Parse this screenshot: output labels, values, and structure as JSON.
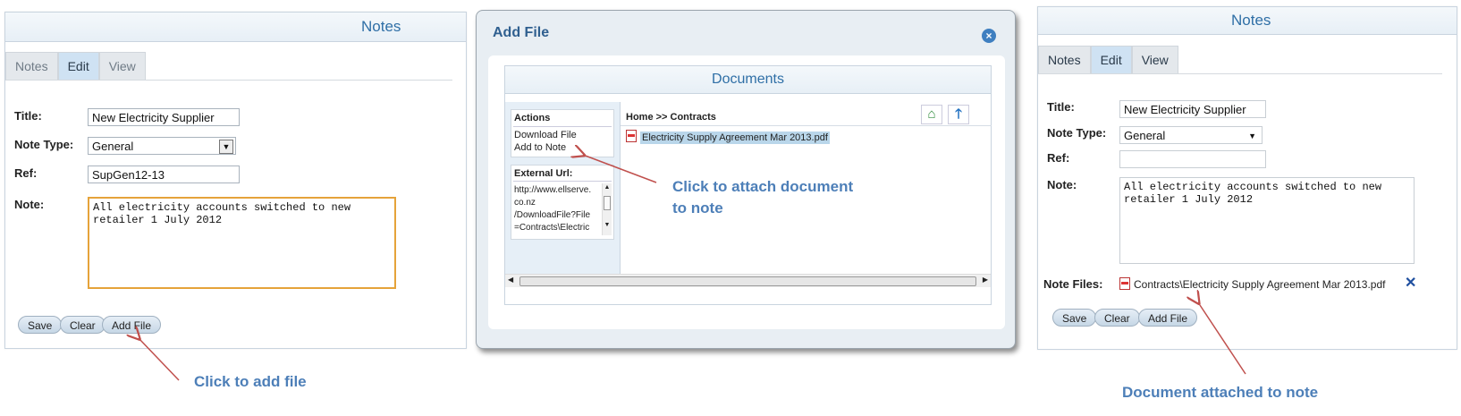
{
  "left_panel": {
    "title": "Notes",
    "tabs": [
      "Notes",
      "Edit",
      "View"
    ],
    "active_tab": "Edit",
    "fields": {
      "title_label": "Title:",
      "title_value": "New Electricity Supplier",
      "note_type_label": "Note Type:",
      "note_type_value": "General",
      "ref_label": "Ref:",
      "ref_value": "SupGen12-13",
      "note_label": "Note:",
      "note_value": "All electricity accounts switched to new\nretailer 1 July 2012"
    },
    "buttons": [
      "Save",
      "Clear",
      "Add File"
    ],
    "annotation": "Click to add file"
  },
  "dialog": {
    "title": "Add File",
    "documents_title": "Documents",
    "actions_header": "Actions",
    "actions": [
      "Download File",
      "Add to Note"
    ],
    "external_url_header": "External Url:",
    "external_url_lines": [
      "http://www.ellserve.",
      "co.nz",
      "/DownloadFile?File",
      "=Contracts\\Electric"
    ],
    "breadcrumb": "Home >> Contracts",
    "file_name": "Electricity Supply Agreement Mar 2013.pdf",
    "annotation": "Click to attach document\nto note"
  },
  "right_panel": {
    "title": "Notes",
    "tabs": [
      "Notes",
      "Edit",
      "View"
    ],
    "active_tab": "Edit",
    "fields": {
      "title_label": "Title:",
      "title_value": "New Electricity Supplier",
      "note_type_label": "Note Type:",
      "note_type_value": "General",
      "ref_label": "Ref:",
      "ref_value": "",
      "note_label": "Note:",
      "note_value": "All electricity accounts switched to new\nretailer 1 July 2012",
      "note_files_label": "Note Files:",
      "note_file": "Contracts\\Electricity Supply Agreement Mar 2013.pdf"
    },
    "buttons": [
      "Save",
      "Clear",
      "Add File"
    ],
    "annotation": "Document attached to note"
  },
  "colors": {
    "accent": "#2f6fa6",
    "annotation": "#4d7fb8",
    "arrow": "#c0504d",
    "focus_border": "#e5a33a"
  }
}
